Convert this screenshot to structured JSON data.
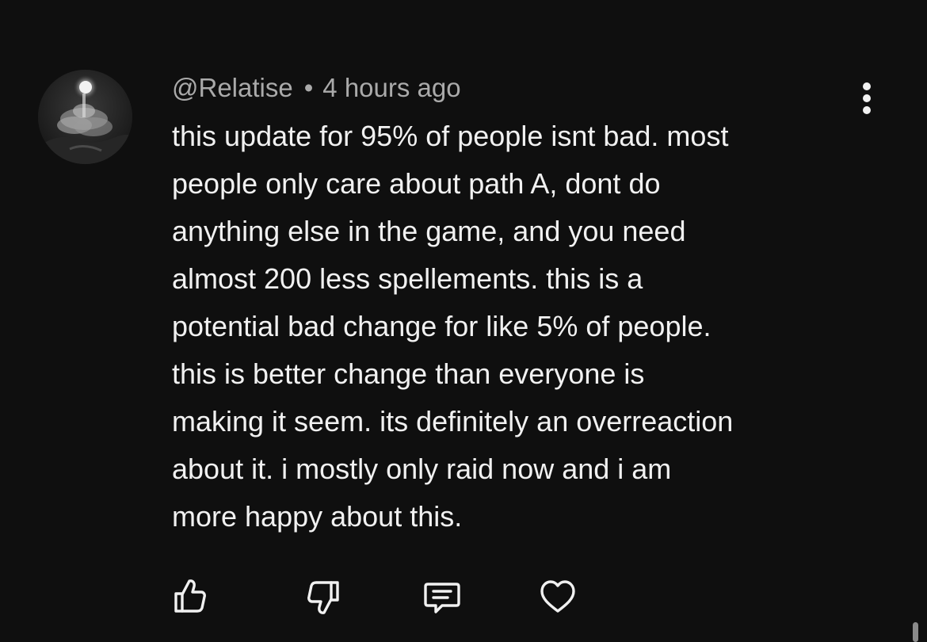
{
  "comment": {
    "author": "@Relatise",
    "separator": "•",
    "timestamp": "4 hours ago",
    "body_lines": [
      "this update for 95% of people isnt bad. most",
      "people only care about path A, dont do",
      "anything else in the game, and you need",
      "almost 200 less spellements. this is a",
      "potential bad change for like 5% of people.",
      "this is better change than everyone is",
      "making it seem. its definitely an overreaction",
      "about it. i mostly only raid now and i am",
      "more happy about this."
    ]
  },
  "icons": {
    "menu": "more-vertical-icon",
    "like": "thumbs-up-icon",
    "dislike": "thumbs-down-icon",
    "reply": "reply-comment-icon",
    "heart": "heart-icon"
  },
  "colors": {
    "background": "#0f0f0f",
    "text_primary": "#f1f1f1",
    "text_secondary": "#aaaaaa"
  }
}
